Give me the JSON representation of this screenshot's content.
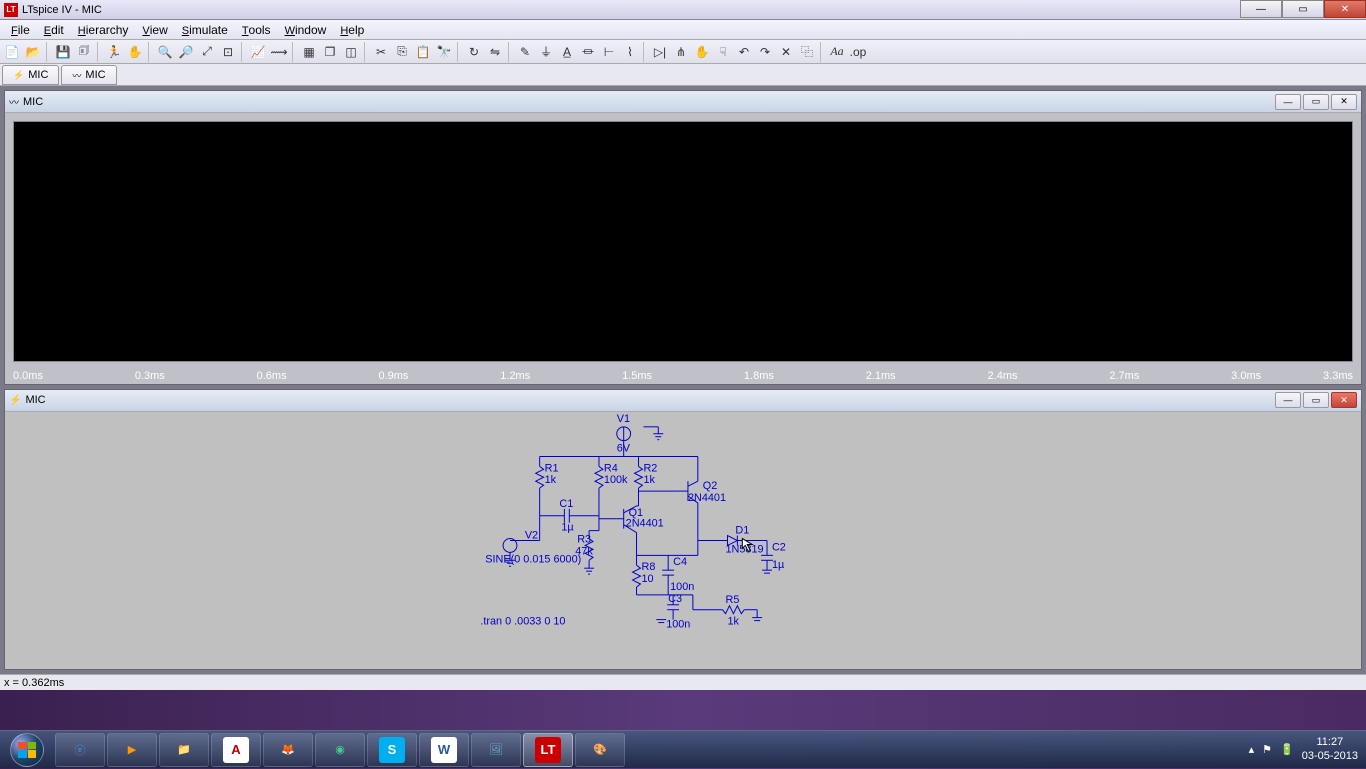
{
  "titlebar": {
    "logo": "LT",
    "title": "LTspice IV - MIC"
  },
  "menu": [
    {
      "label": "File",
      "key": "F"
    },
    {
      "label": "Edit",
      "key": "E"
    },
    {
      "label": "Hierarchy",
      "key": "H"
    },
    {
      "label": "View",
      "key": "V"
    },
    {
      "label": "Simulate",
      "key": "S"
    },
    {
      "label": "Tools",
      "key": "T"
    },
    {
      "label": "Window",
      "key": "W"
    },
    {
      "label": "Help",
      "key": "H"
    }
  ],
  "toolbar": [
    {
      "name": "new-schematic",
      "glyph": "📄"
    },
    {
      "name": "open",
      "glyph": "📂"
    },
    {
      "name": "sep"
    },
    {
      "name": "save",
      "glyph": "💾"
    },
    {
      "name": "print",
      "glyph": "🗊"
    },
    {
      "name": "sep"
    },
    {
      "name": "run",
      "glyph": "🏃"
    },
    {
      "name": "halt",
      "glyph": "✋"
    },
    {
      "name": "sep"
    },
    {
      "name": "zoom-in",
      "glyph": "🔍"
    },
    {
      "name": "zoom-out",
      "glyph": "🔎"
    },
    {
      "name": "zoom-area",
      "glyph": "⤢"
    },
    {
      "name": "zoom-fit",
      "glyph": "⊡"
    },
    {
      "name": "sep"
    },
    {
      "name": "autorange",
      "glyph": "📈"
    },
    {
      "name": "pick",
      "glyph": "⟿"
    },
    {
      "name": "sep"
    },
    {
      "name": "tile",
      "glyph": "▦"
    },
    {
      "name": "cascade",
      "glyph": "❐"
    },
    {
      "name": "copy-bmp",
      "glyph": "◫"
    },
    {
      "name": "sep"
    },
    {
      "name": "cut",
      "glyph": "✂"
    },
    {
      "name": "copy",
      "glyph": "⎘"
    },
    {
      "name": "paste",
      "glyph": "📋"
    },
    {
      "name": "find",
      "glyph": "🔭"
    },
    {
      "name": "sep"
    },
    {
      "name": "rotate",
      "glyph": "↻"
    },
    {
      "name": "mirror",
      "glyph": "⇋"
    },
    {
      "name": "sep"
    },
    {
      "name": "draw-wire",
      "glyph": "✎"
    },
    {
      "name": "ground",
      "glyph": "⏚"
    },
    {
      "name": "label",
      "glyph": "A̲"
    },
    {
      "name": "resistor",
      "glyph": "⏛"
    },
    {
      "name": "capacitor",
      "glyph": "⊢"
    },
    {
      "name": "inductor",
      "glyph": "⌇"
    },
    {
      "name": "sep"
    },
    {
      "name": "diode",
      "glyph": "▷|"
    },
    {
      "name": "component",
      "glyph": "⋔"
    },
    {
      "name": "move",
      "glyph": "✋"
    },
    {
      "name": "drag",
      "glyph": "☟"
    },
    {
      "name": "undo",
      "glyph": "↶"
    },
    {
      "name": "redo",
      "glyph": "↷"
    },
    {
      "name": "delete",
      "glyph": "✕"
    },
    {
      "name": "duplicate",
      "glyph": "⿻"
    },
    {
      "name": "sep"
    },
    {
      "name": "text",
      "glyph": "Aa"
    },
    {
      "name": "spice",
      "glyph": ".op"
    }
  ],
  "doctabs": [
    {
      "icon": "⚡",
      "label": "MIC",
      "name": "schematic-tab"
    },
    {
      "icon": "〰",
      "label": "MIC",
      "name": "waveform-tab"
    }
  ],
  "waveform_panel": {
    "icon": "〰",
    "title": "MIC",
    "xaxis": [
      "0.0ms",
      "0.3ms",
      "0.6ms",
      "0.9ms",
      "1.2ms",
      "1.5ms",
      "1.8ms",
      "2.1ms",
      "2.4ms",
      "2.7ms",
      "3.0ms",
      "3.3ms"
    ]
  },
  "schematic_panel": {
    "icon": "⚡",
    "title": "MIC",
    "directive": ".tran 0 .0033 0 10",
    "components": {
      "V1": {
        "label": "V1",
        "value": "6V"
      },
      "V2": {
        "label": "V2",
        "value": "SINE(0 0.015 6000)"
      },
      "R1": {
        "label": "R1",
        "value": "1k"
      },
      "R4": {
        "label": "R4",
        "value": "100k"
      },
      "R2": {
        "label": "R2",
        "value": "1k"
      },
      "R3": {
        "label": "R3",
        "value": "47k"
      },
      "R8": {
        "label": "R8",
        "value": "10"
      },
      "R5": {
        "label": "R5",
        "value": "1k"
      },
      "C1": {
        "label": "C1",
        "value": "1µ"
      },
      "C4": {
        "label": "C4",
        "value": "100n"
      },
      "C3": {
        "label": "C3",
        "value": "100n"
      },
      "C2": {
        "label": "C2",
        "value": "1µ"
      },
      "Q1": {
        "label": "Q1",
        "value": "2N4401"
      },
      "Q2": {
        "label": "Q2",
        "value": "2N4401"
      },
      "D1": {
        "label": "D1",
        "value": "1N5819"
      }
    }
  },
  "statusbar": {
    "text": "x = 0.362ms"
  },
  "taskbar": {
    "apps": [
      {
        "name": "ie",
        "glyph": "ⓔ",
        "color": "#3a98e8"
      },
      {
        "name": "media-player",
        "glyph": "▶",
        "color": "#f90"
      },
      {
        "name": "explorer",
        "glyph": "📁",
        "color": "#f4d060"
      },
      {
        "name": "adobe-reader",
        "glyph": "A",
        "color": "#b00",
        "bg": "#fff"
      },
      {
        "name": "firefox",
        "glyph": "🦊",
        "color": "#f60"
      },
      {
        "name": "chrome",
        "glyph": "◉",
        "color": "#4c8"
      },
      {
        "name": "skype",
        "glyph": "S",
        "color": "#fff",
        "bg": "#00aff0"
      },
      {
        "name": "word",
        "glyph": "W",
        "color": "#2b579a",
        "bg": "#fff"
      },
      {
        "name": "photo-viewer",
        "glyph": "🖼",
        "color": "#6ac"
      },
      {
        "name": "ltspice",
        "glyph": "LT",
        "color": "#fff",
        "bg": "#c00",
        "active": true
      },
      {
        "name": "paint",
        "glyph": "🎨",
        "color": "#d44"
      }
    ],
    "tray": {
      "time": "11:27",
      "date": "03-05-2013"
    }
  }
}
